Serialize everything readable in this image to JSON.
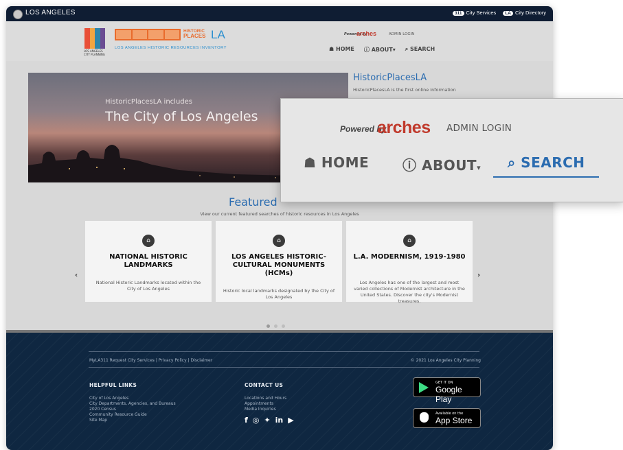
{
  "topbar": {
    "city": "LOS ANGELES",
    "services_badge": "311",
    "services_label": "City Services",
    "directory_badge": "LA",
    "directory_label": "City Directory"
  },
  "header": {
    "logo_dept": "LOS ANGELES CITY PLANNING",
    "logo_historic": "HISTORIC",
    "logo_places": "PLACES",
    "logo_la": "LA",
    "logo_inventory": "LOS ANGELES HISTORIC RESOURCES INVENTORY",
    "powered_by": "Powered by",
    "arches": "arches",
    "admin_login": "ADMIN LOGIN",
    "nav": {
      "home": "HOME",
      "about": "ABOUT",
      "search": "SEARCH"
    }
  },
  "hero": {
    "line1": "HistoricPlacesLA includes",
    "line2": "The City of Los Angeles"
  },
  "sidebar": {
    "title": "HistoricPlacesLA",
    "text": "HistoricPlacesLA is the first online information"
  },
  "featured": {
    "title": "Featured",
    "subtitle": "View our current featured searches of historic resources in Los Angeles",
    "cards": [
      {
        "title": "NATIONAL HISTORIC LANDMARKS",
        "desc": "National Historic Landmarks located within the City of Los Angeles"
      },
      {
        "title": "LOS ANGELES HISTORIC-CULTURAL MONUMENTS (HCMs)",
        "desc": "Historic local landmarks designated by the City of Los Angeles"
      },
      {
        "title": "L.A. MODERNISM, 1919-1980",
        "desc": "Los Angeles has one of the largest and most varied collections of Modernist architecture in the United States. Discover the city's Modernist treasures."
      }
    ],
    "prev": "‹",
    "next": "›"
  },
  "footer": {
    "links_row": "MyLA311  Request City Services  |  Privacy Policy  |  Disclaimer",
    "copyright": "© 2021 Los Angeles City Planning",
    "helpful_title": "HELPFUL LINKS",
    "helpful": [
      "City of Los Angeles",
      "City Departments, Agencies, and Bureaus",
      "2020 Census",
      "Community Resource Guide",
      "Site Map"
    ],
    "contact_title": "CONTACT US",
    "contact": [
      "Locations and Hours",
      "Appointments",
      "Media Inquiries"
    ],
    "google_small": "GET IT ON",
    "google_big": "Google Play",
    "apple_small": "Available on the",
    "apple_big": "App Store"
  },
  "zoom": {
    "powered_by": "Powered by",
    "arches": "arches",
    "admin_login": "ADMIN LOGIN",
    "home": "HOME",
    "about": "ABOUT",
    "search": "SEARCH"
  },
  "colors": {
    "navy": "#0f1d33",
    "accent": "#2b6cb0",
    "arches_red": "#c0392b",
    "orange": "#e96b2c"
  }
}
